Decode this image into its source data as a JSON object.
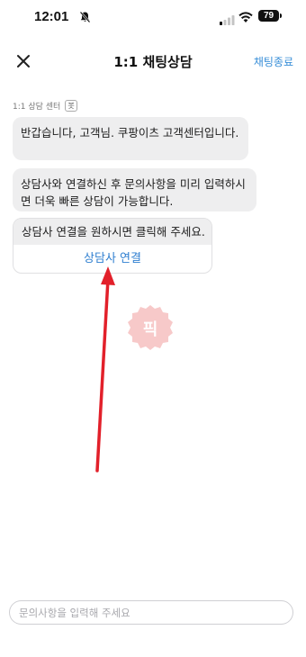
{
  "status_bar": {
    "time": "12:01",
    "battery": "79",
    "icons": [
      "bell-slash-icon",
      "signal-icon",
      "wifi-icon",
      "battery-icon"
    ]
  },
  "header": {
    "close_icon": "close-icon",
    "title": "1:1 채팅상담",
    "end_chat_label": "채팅종료"
  },
  "chat": {
    "sender": "1:1 상담 센터",
    "badge": "봇",
    "messages": [
      "반갑습니다, 고객님. 쿠팡이츠 고객센터입니다.",
      "상담사와 연결하신 후 문의사항을 미리 입력하시면 더욱 빠른 상담이 가능합니다."
    ],
    "action_card": {
      "text": "상담사 연결을 원하시면 클릭해 주세요.",
      "button_label": "상담사 연결"
    }
  },
  "watermark": {
    "text": "픽",
    "color": "#f7c9c9"
  },
  "annotation": {
    "arrow_color": "#e2202a"
  },
  "input": {
    "placeholder": "문의사항을 입력해 주세요",
    "value": ""
  },
  "colors": {
    "accent": "#2f7fd0",
    "bubble_bg": "#eeeeef"
  }
}
